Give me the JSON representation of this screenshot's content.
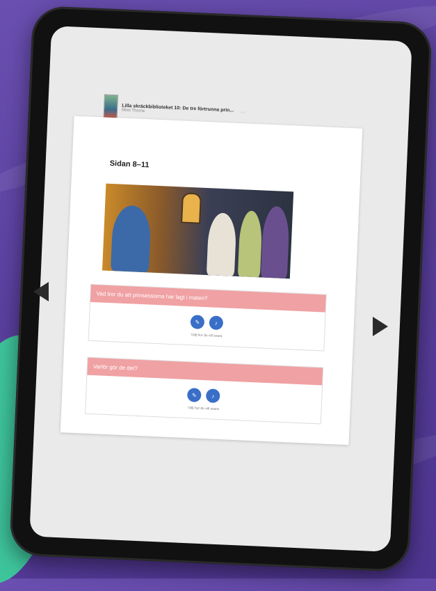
{
  "book": {
    "title": "Lilla skräckbiblioteket 10: De tre förtrunna prin...",
    "author": "Mimi Thorne",
    "more": "‹ ›"
  },
  "page": {
    "title": "Sidan 8–11"
  },
  "questions": [
    {
      "text": "Vad tror du att prinsessorna har lagt i maten?",
      "btn_write": "✎",
      "btn_audio": "♪",
      "hint": "Välj hur du vill svara"
    },
    {
      "text": "Varför gör de det?",
      "btn_write": "✎",
      "btn_audio": "♪",
      "hint": "Välj hur du vill svara"
    }
  ],
  "nav": {
    "prev_icon": "arrow-left-icon",
    "next_icon": "arrow-right-icon"
  },
  "colors": {
    "background": "#5a3f9e",
    "accent_green": "#3ec49b",
    "question_header": "#f0a1a3",
    "button_blue": "#3a6fc7"
  }
}
